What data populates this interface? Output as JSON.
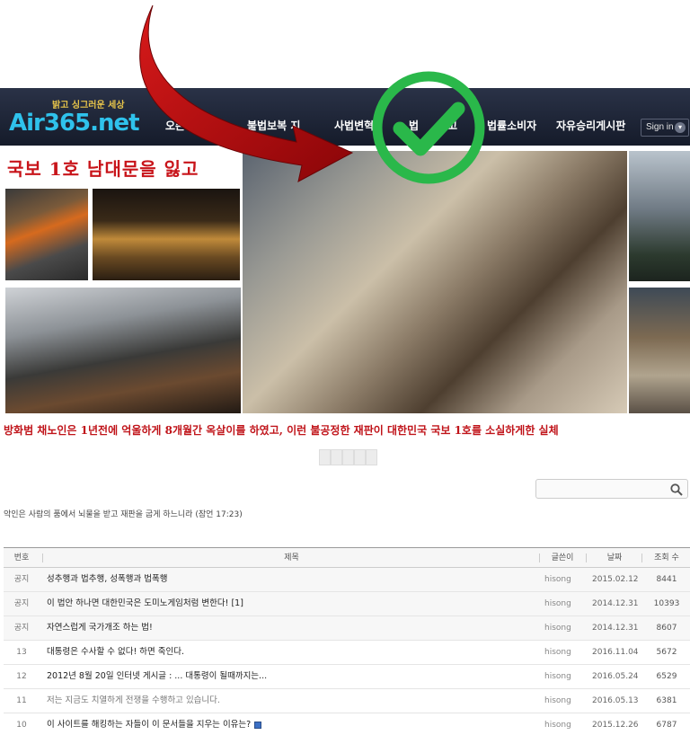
{
  "site": {
    "logo_tag": "밝고 싱그러운 세상",
    "logo_text": "Air365.net"
  },
  "nav": {
    "items": [
      {
        "label": "오존공"
      },
      {
        "label": "불법보복 지"
      },
      {
        "label": "사법변혁"
      },
      {
        "label": "법"
      },
      {
        "label": "신고"
      },
      {
        "label": "법률소비자"
      },
      {
        "label": "자유승리게시판"
      }
    ],
    "signin_label": "Sign in"
  },
  "banner": {
    "title": "국보 1호 남대문을 잃고",
    "caption": "방화범 채노인은 1년전에 억울하게 8개월간 옥살이를 하였고, 이런 불공정한 재판이 대한민국 국보 1호를 소실하게한 실체"
  },
  "search": {
    "placeholder": ""
  },
  "quote": "악인은 사람의 품에서 뇌물을 받고 재판을 굽게 하느니라 (잠언 17:23)",
  "board": {
    "headers": {
      "num": "번호",
      "subject": "제목",
      "author": "글쓴이",
      "date": "날짜",
      "hits": "조회 수"
    },
    "rows": [
      {
        "num": "공지",
        "subject": "성추행과 법추행, 성폭행과 법폭행",
        "author": "hisong",
        "date": "2015.02.12",
        "hits": "8441"
      },
      {
        "num": "공지",
        "subject": "이 법안 하나면 대한민국은 도미노게임처럼 변한다! [1]",
        "author": "hisong",
        "date": "2014.12.31",
        "hits": "10393"
      },
      {
        "num": "공지",
        "subject": "자연스럽게 국가개조 하는 법!",
        "author": "hisong",
        "date": "2014.12.31",
        "hits": "8607"
      },
      {
        "num": "13",
        "subject": "대통령은 수사할 수 없다! 하면 죽인다.",
        "author": "hisong",
        "date": "2016.11.04",
        "hits": "5672"
      },
      {
        "num": "12",
        "subject": "2012년 8월 20일 인터넷 게시글 : ... 대통령이 될때까지는...",
        "author": "hisong",
        "date": "2016.05.24",
        "hits": "6529"
      },
      {
        "num": "11",
        "subject": "저는 지금도 치열하게 전쟁을 수행하고 있습니다.",
        "author": "hisong",
        "date": "2016.05.13",
        "hits": "6381"
      },
      {
        "num": "10",
        "subject": "이 사이트를 해킹하는 자들이 이 문서들을 지우는 이유는?",
        "author": "hisong",
        "date": "2015.12.26",
        "hits": "6787"
      }
    ]
  },
  "colors": {
    "navbar": "#1c2233",
    "logo": "#2fc2ec",
    "banner_text": "#c8141a",
    "arrow": "#b5080c",
    "check": "#2ab84a"
  }
}
